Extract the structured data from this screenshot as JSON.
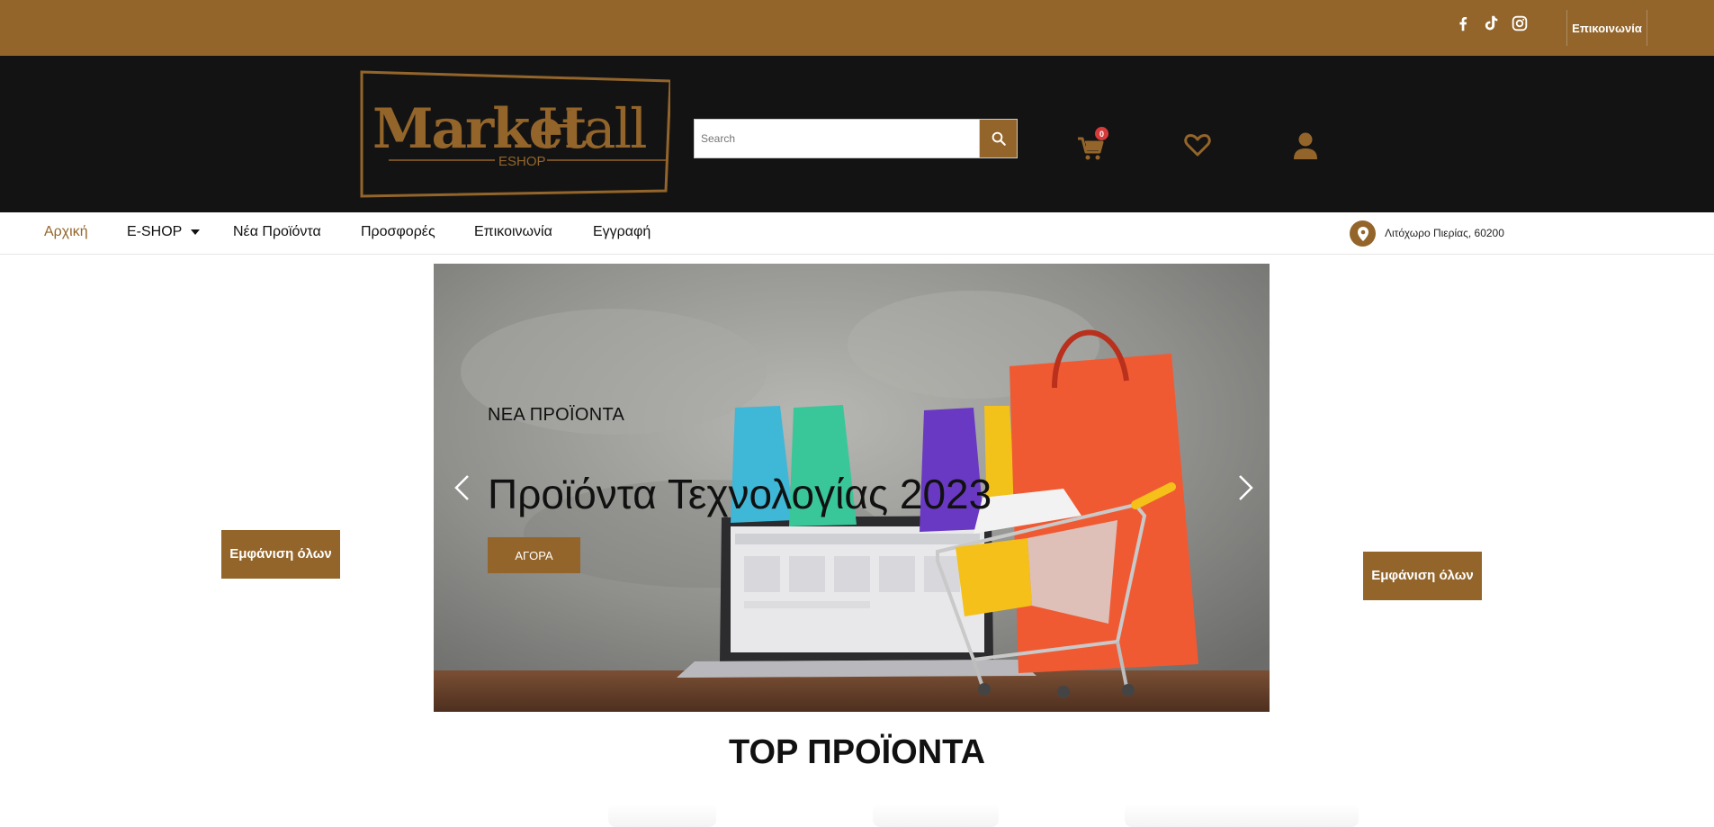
{
  "topbar": {
    "contact_label": "Επικοινωνία",
    "social_icons": [
      "facebook-icon",
      "tiktok-icon",
      "instagram-icon"
    ]
  },
  "header": {
    "logo": {
      "brand": "MarketHall",
      "sub": "ESHOP"
    },
    "search": {
      "placeholder": "Search"
    },
    "cart_count": "0"
  },
  "nav": {
    "items": [
      {
        "label": "Αρχική",
        "active": true
      },
      {
        "label": "E-SHOP",
        "dropdown": true
      },
      {
        "label": "Νέα Προϊόντα"
      },
      {
        "label": "Προσφορές"
      },
      {
        "label": "Επικοινωνία"
      },
      {
        "label": "Εγγραφή"
      }
    ],
    "location": "Λιτόχωρο Πιερίας, 60200"
  },
  "slider": {
    "kicker": "ΝΕΑ ΠΡΟΪΟΝΤΑ",
    "title": "Προϊόντα Τεχνολογίας 2023",
    "button": "ΑΓΟΡΑ"
  },
  "side_buttons": {
    "left": "Εμφάνιση όλων",
    "right": "Εμφάνιση όλων"
  },
  "section": {
    "title": "TOP ΠΡΟΪΟΝΤΑ"
  },
  "colors": {
    "brand": "#93652b",
    "header_bg": "#141313",
    "badge": "#d63b3b"
  }
}
